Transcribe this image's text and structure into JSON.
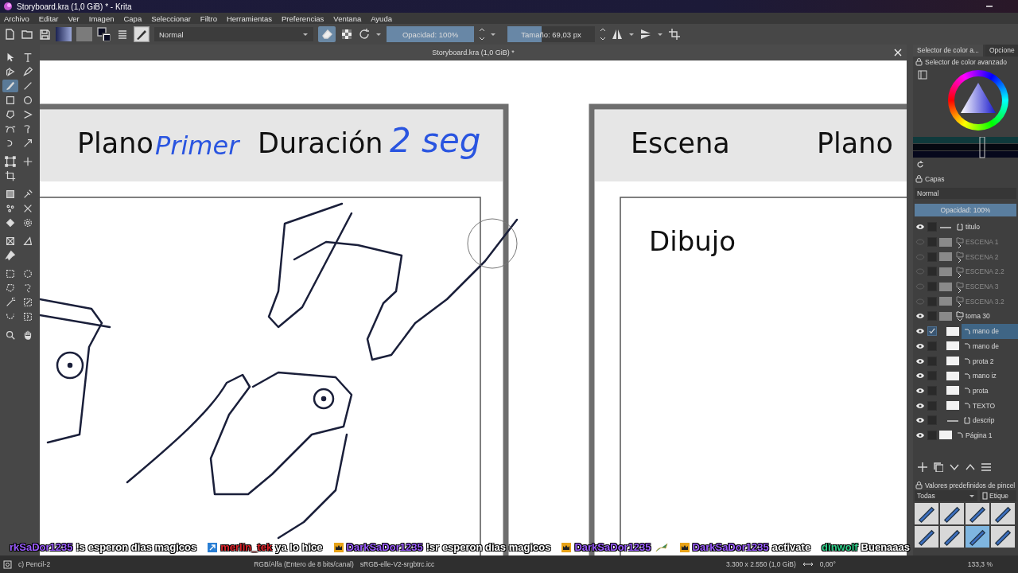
{
  "window": {
    "title": "Storyboard.kra (1,0 GiB) * - Krita"
  },
  "menu": [
    "Archivo",
    "Editar",
    "Ver",
    "Imagen",
    "Capa",
    "Seleccionar",
    "Filtro",
    "Herramientas",
    "Preferencias",
    "Ventana",
    "Ayuda"
  ],
  "toolbar": {
    "blend_mode": "Normal",
    "eraser_on": true,
    "opacity": {
      "label": "Opacidad: 100%",
      "level": 1
    },
    "size": {
      "label": "Tamaño: 69,03 px",
      "level": 0.39
    }
  },
  "tool_groups": [
    [
      {
        "kind": "select-shape",
        "selected": false
      },
      {
        "kind": "text",
        "selected": false
      },
      {
        "kind": "edit-shape",
        "selected": false
      },
      {
        "kind": "calligraphy",
        "selected": false
      },
      {
        "kind": "brush",
        "selected": true
      },
      {
        "kind": "line",
        "selected": false
      },
      {
        "kind": "rectangle",
        "selected": false
      },
      {
        "kind": "ellipse",
        "selected": false
      },
      {
        "kind": "polygon",
        "selected": false
      },
      {
        "kind": "polyline",
        "selected": false
      },
      {
        "kind": "bezier",
        "selected": false
      },
      {
        "kind": "freehand-path",
        "selected": false
      },
      {
        "kind": "dynamic-brush",
        "selected": false
      },
      {
        "kind": "multibrush",
        "selected": false
      }
    ],
    [
      {
        "kind": "transform",
        "selected": false
      },
      {
        "kind": "move",
        "selected": false
      },
      {
        "kind": "crop",
        "selected": false
      }
    ],
    [
      {
        "kind": "gradient",
        "selected": false
      },
      {
        "kind": "color-picker",
        "selected": false
      },
      {
        "kind": "colorize",
        "selected": false
      },
      {
        "kind": "smart-patch",
        "selected": false
      },
      {
        "kind": "fill",
        "selected": false
      },
      {
        "kind": "enclose-fill",
        "selected": false
      }
    ],
    [
      {
        "kind": "assistant",
        "selected": false
      },
      {
        "kind": "measure",
        "selected": false
      },
      {
        "kind": "reference",
        "selected": false
      }
    ],
    [
      {
        "kind": "rect-select",
        "selected": false
      },
      {
        "kind": "ellipse-select",
        "selected": false
      },
      {
        "kind": "polygon-select",
        "selected": false
      },
      {
        "kind": "freehand-select",
        "selected": false
      },
      {
        "kind": "magic-wand",
        "selected": false
      },
      {
        "kind": "similar-select",
        "selected": false
      },
      {
        "kind": "bezier-select",
        "selected": false
      },
      {
        "kind": "magnetic-select",
        "selected": false
      }
    ],
    [
      {
        "kind": "zoom",
        "selected": false
      },
      {
        "kind": "pan",
        "selected": false
      }
    ]
  ],
  "document": {
    "title": "Storyboard.kra (1,0 GiB) *",
    "panels": [
      {
        "labels": [
          "Plano",
          "Duración"
        ],
        "handwriting": [
          "Primer",
          "2 seg"
        ]
      },
      {
        "labels": [
          "Escena",
          "Plano"
        ],
        "caption": "Dibujo"
      }
    ]
  },
  "color_selector": {
    "tabs": [
      {
        "label": "Selector de color a...",
        "selected": true
      },
      {
        "label": "Opcione",
        "selected": false
      }
    ],
    "title": "Selector de color avanzado"
  },
  "layers": {
    "title": "Capas",
    "blend_mode": "Normal",
    "opacity": {
      "label": "Opacidad:  100%",
      "level": 1
    },
    "items": [
      {
        "name": "titulo",
        "kind": "vector",
        "visible": true,
        "selected": false
      },
      {
        "name": "ESCENA 1",
        "kind": "group",
        "visible": false,
        "selected": false,
        "expanded": false
      },
      {
        "name": "ESCENA 2",
        "kind": "group",
        "visible": false,
        "selected": false,
        "expanded": false
      },
      {
        "name": "ESCENA 2.2",
        "kind": "group",
        "visible": false,
        "selected": false,
        "expanded": false
      },
      {
        "name": "ESCENA 3",
        "kind": "group",
        "visible": false,
        "selected": false,
        "expanded": false
      },
      {
        "name": "ESCENA 3.2",
        "kind": "group",
        "visible": false,
        "selected": false,
        "expanded": false
      },
      {
        "name": "toma 30",
        "kind": "group",
        "visible": true,
        "selected": false,
        "expanded": true,
        "children": [
          {
            "name": "mano de",
            "kind": "paint",
            "visible": true,
            "selected": true
          },
          {
            "name": "mano de",
            "kind": "paint",
            "visible": true,
            "selected": false
          },
          {
            "name": "prota 2",
            "kind": "paint",
            "visible": true,
            "selected": false
          },
          {
            "name": "mano iz",
            "kind": "paint",
            "visible": true,
            "selected": false
          },
          {
            "name": "prota",
            "kind": "paint",
            "visible": true,
            "selected": false
          },
          {
            "name": "TEXTO",
            "kind": "paint",
            "visible": true,
            "selected": false
          },
          {
            "name": "descrip",
            "kind": "vector",
            "visible": true,
            "selected": false
          }
        ]
      },
      {
        "name": "Página 1",
        "kind": "paint",
        "visible": true,
        "selected": false
      }
    ]
  },
  "brush_presets": {
    "title": "Valores predefinidos de pincel",
    "filter": "Todas",
    "tag": "Etique",
    "items": [
      {
        "selected": false
      },
      {
        "selected": false
      },
      {
        "selected": false
      },
      {
        "selected": false
      },
      {
        "selected": false
      },
      {
        "selected": false
      },
      {
        "selected": true
      },
      {
        "selected": false
      }
    ]
  },
  "status_bar": {
    "brush": "c) Pencil-2",
    "color_space": "RGB/Alfa (Entero de 8 bits/canal)",
    "profile": "sRGB-elle-V2-srgbtrc.icc",
    "size": "3.300 x 2.550 (1,0 GiB)",
    "rotation": "0,00°",
    "zoom": "133,3 %"
  },
  "chat": [
    {
      "user": "rkSaDor1235",
      "text": "!s esperon dias magicos",
      "color": "#9b5cff",
      "kind": "plain"
    },
    {
      "user": "merlin_tek",
      "text": "ya lo hice",
      "color": "#e0242b",
      "kind": "arrow"
    },
    {
      "user": "DarkSaDor1235",
      "text": "!sr esperon dias magicos",
      "color": "#9b5cff",
      "kind": "crown"
    },
    {
      "user": "DarkSaDor1235",
      "color": "#9b5cff",
      "kind": "crown",
      "emote": true
    },
    {
      "user": "DarkSaDor1235",
      "text": "activate",
      "color": "#9b5cff",
      "kind": "crown"
    },
    {
      "user": "dinwolf",
      "text": "Buenaaas",
      "color": "#2fd08a",
      "kind": "plain"
    }
  ]
}
